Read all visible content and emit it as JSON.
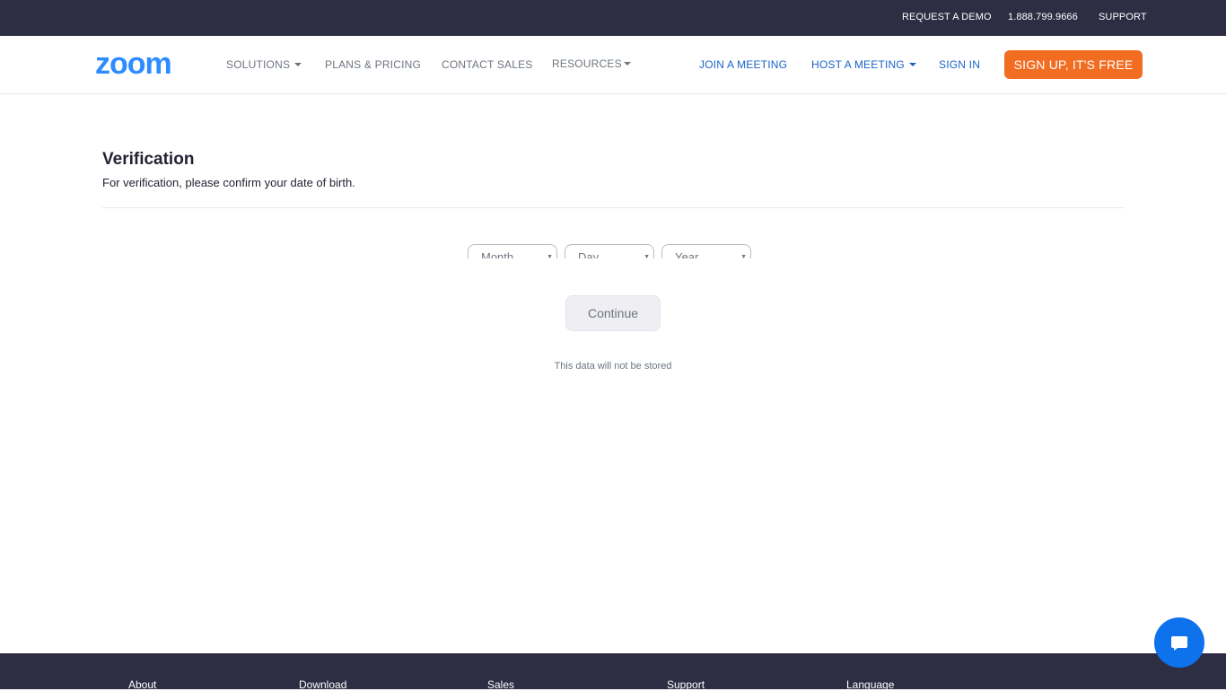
{
  "topbar": {
    "request_demo": "REQUEST A DEMO",
    "phone": "1.888.799.9666",
    "support": "SUPPORT"
  },
  "navbar": {
    "logo_text": "zoom",
    "solutions": "SOLUTIONS",
    "plans_pricing": "PLANS & PRICING",
    "contact_sales": "CONTACT SALES",
    "resources": "RESOURCES",
    "join_meeting": "JOIN A MEETING",
    "host_meeting": "HOST A MEETING",
    "sign_in": "SIGN IN",
    "sign_up": "SIGN UP, IT'S FREE"
  },
  "main": {
    "title": "Verification",
    "subtitle": "For verification, please confirm your date of birth.",
    "month_select": "Month",
    "day_select": "Day",
    "year_select": "Year",
    "continue": "Continue",
    "note": "This data will not be stored"
  },
  "footer": {
    "about": "About",
    "download": "Download",
    "sales": "Sales",
    "support": "Support",
    "language": "Language"
  },
  "colors": {
    "topbar_bg": "#2d2e44",
    "brand_blue": "#0e72ed",
    "signup_orange": "#f26d21",
    "nav_link_blue": "#1a63c9"
  },
  "icons": {
    "chat": "chat-bubble-icon",
    "caret": "caret-down-icon"
  }
}
